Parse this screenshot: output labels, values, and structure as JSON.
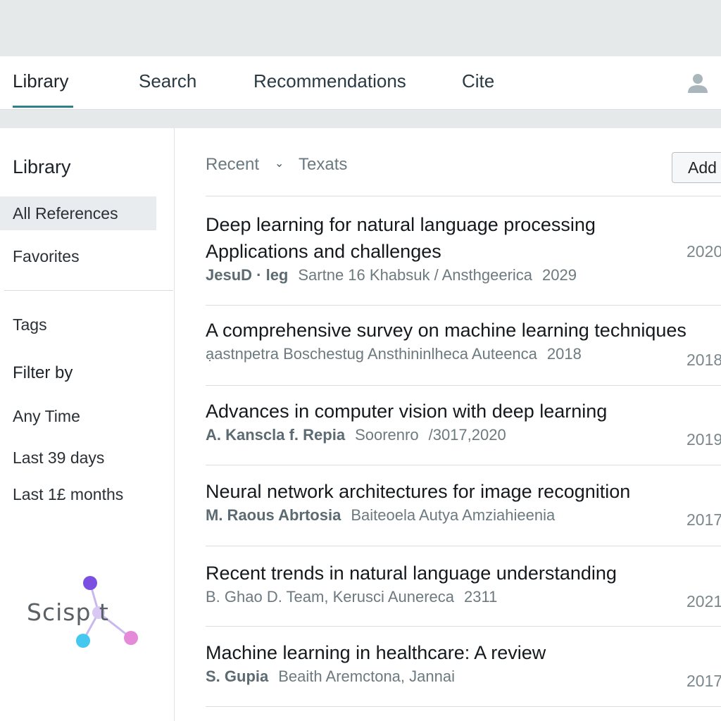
{
  "nav": {
    "tabs": [
      {
        "label": "Library",
        "active": true
      },
      {
        "label": "Search"
      },
      {
        "label": "Recommendations"
      },
      {
        "label": "Cite"
      }
    ],
    "user_icon": "user-icon"
  },
  "sidebar": {
    "title": "Library",
    "items": [
      {
        "label": "All References",
        "selected": true
      },
      {
        "label": "Favorites"
      }
    ],
    "tags_label": "Tags",
    "filter_label": "Filter by",
    "filters": [
      "Any Time",
      "Last 39 days",
      "Last 1£ months"
    ],
    "logo_text": "Scisp  t"
  },
  "toolbar": {
    "sort_label": "Recent",
    "type_label": "Texats",
    "add_label": "Add"
  },
  "references": [
    {
      "title_lines": [
        "Deep learning for natural language processing",
        "Applications and challenges"
      ],
      "author": "JesuD · leg",
      "pub": "Sartne 16 Khabsuk / Ansthgeerica",
      "meta_year": "2029",
      "year": "2020"
    },
    {
      "title_lines": [
        "A comprehensive survey on machine learning techniques"
      ],
      "author": "",
      "pub": "ạastnpetra   Boschestug   Ansthininlheca  Auteenca",
      "meta_year": "2018",
      "year": "2018"
    },
    {
      "title_lines": [
        "Advances in computer vision with deep learning"
      ],
      "author": "A. Kanscla f.  Repia",
      "pub": "Soorenro",
      "meta_year": "/3017,2020",
      "year": "2019"
    },
    {
      "title_lines": [
        "Neural network architectures for image recognition"
      ],
      "author": "M. Raous   Abrtosia",
      "pub": "Baiteoela  Autya Amziahieenia",
      "meta_year": "",
      "year": "2017"
    },
    {
      "title_lines": [
        "Recent trends in natural language understanding"
      ],
      "author": "",
      "pub": "B. Ghao D. Team, Kerusci Aunereca",
      "meta_year": "2311",
      "year": "2021"
    },
    {
      "title_lines": [
        "Machine learning in healthcare: A review"
      ],
      "author": "S. Gupia",
      "pub": "Beaith Aremctona, Jannai",
      "meta_year": "",
      "year": "2017"
    }
  ],
  "colors": {
    "accent": "#2f7f8c",
    "logo_purple": "#7b4fe0",
    "logo_pink": "#e58ad8",
    "logo_cyan": "#45c8f0"
  }
}
